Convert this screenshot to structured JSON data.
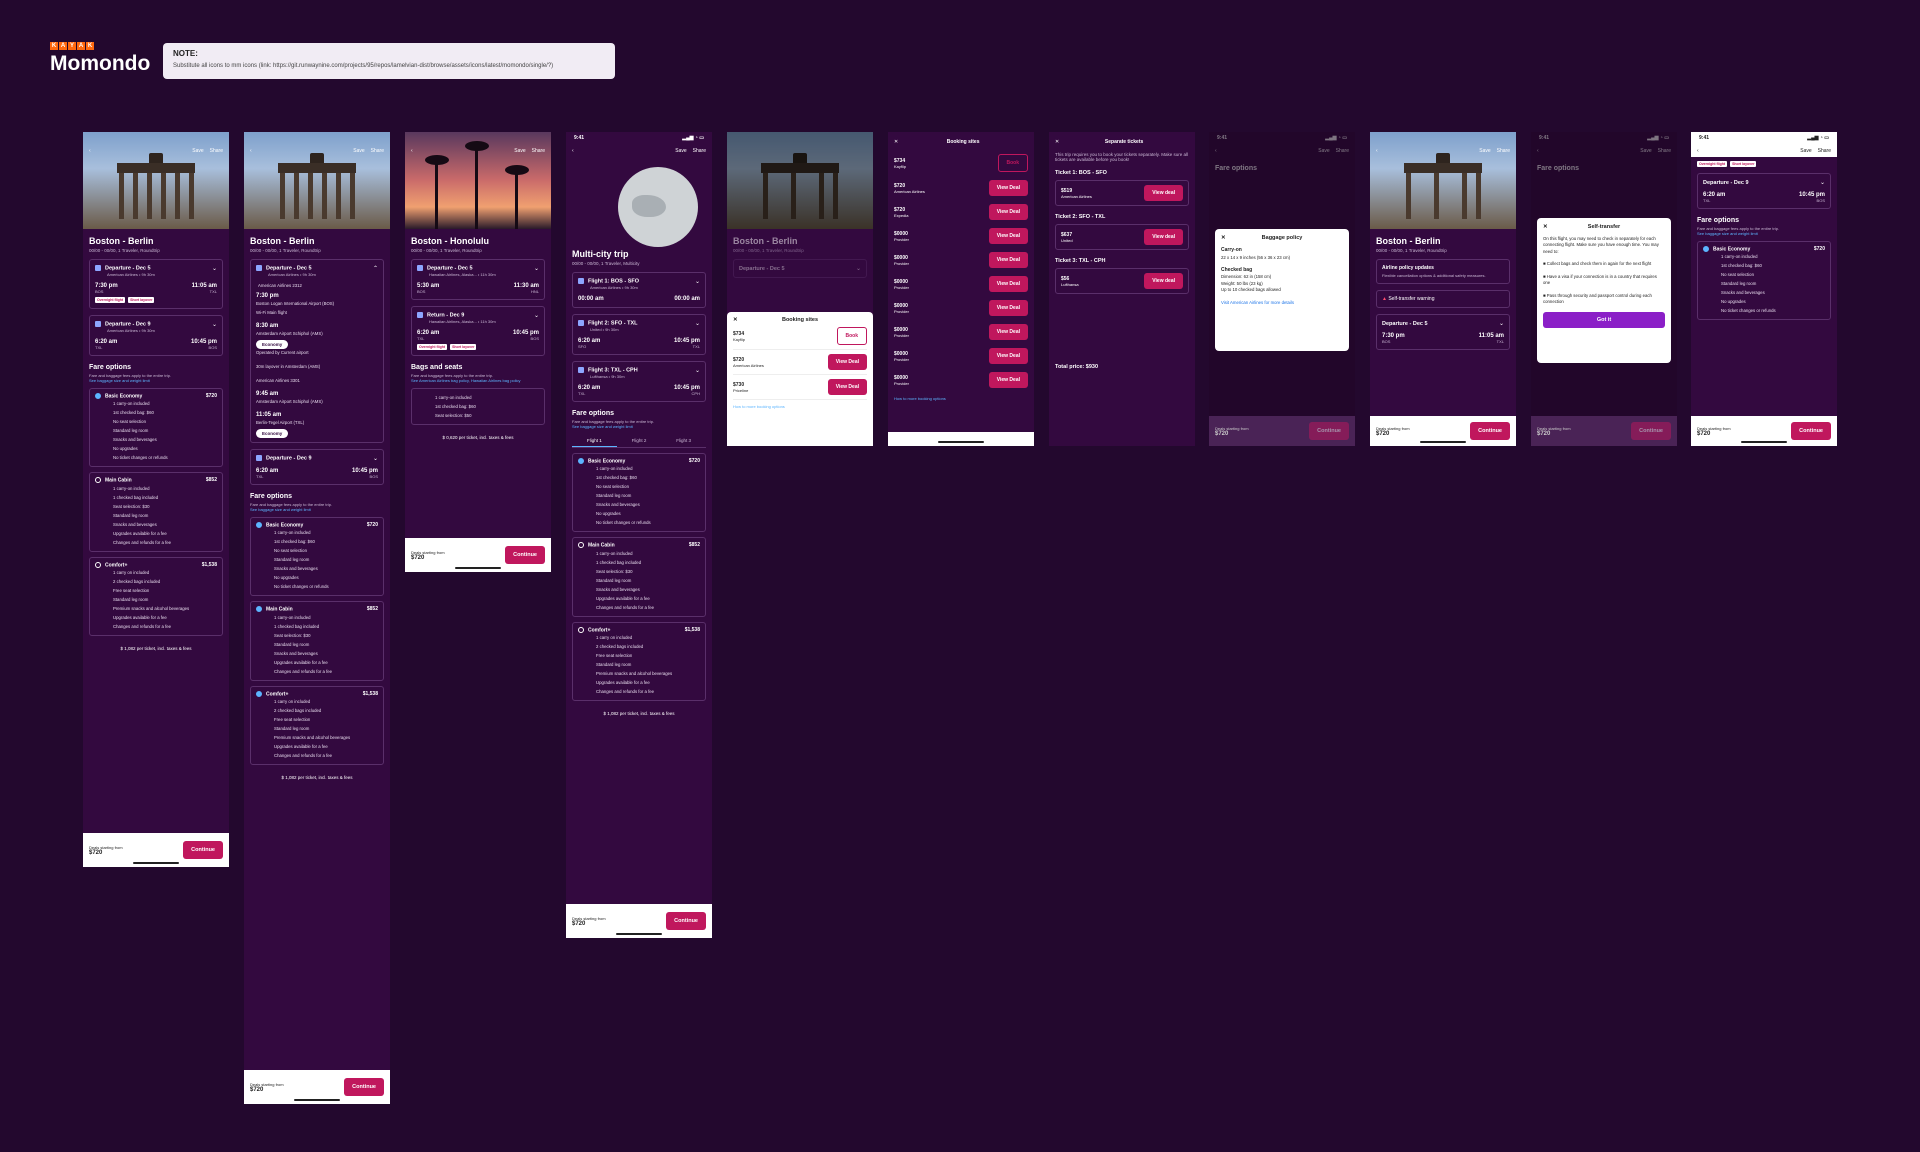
{
  "brand": {
    "kayak": "KAYAK",
    "name": "Momondo"
  },
  "note": {
    "title": "NOTE:",
    "body": "Substitute all icons to mm icons (link: https://git.runwaynine.com/projects/95/repos/lamelvian-dist/browse/assets/icons/latest/momondo/single/?)"
  },
  "status": {
    "time": "9:41"
  },
  "nav": {
    "save": "Save",
    "share": "Share"
  },
  "trips": {
    "bos_ber": {
      "title": "Boston - Berlin",
      "sub": "00/00 - 00/00, 1 Traveler, Roundtrip"
    },
    "bos_hnl": {
      "title": "Boston - Honolulu",
      "sub": "00/00 - 00/00, 1 Traveler, Roundtrip"
    },
    "multi": {
      "title": "Multi-city trip",
      "sub": "00/00 - 00/00, 1 Traveler, Multicity"
    }
  },
  "flights": {
    "dep": {
      "title": "Departure - Dec 5",
      "airline": "American Airlines • 9h 30m",
      "t1": "7:30 pm",
      "a1": "BOS",
      "d1": "Thu, Dec 5",
      "t2": "11:05 am",
      "a2": "TXL",
      "d2": "Fri, Dec 6",
      "stop": "1 stop"
    },
    "ret": {
      "title": "Departure - Dec 9",
      "airline": "American Airlines • 9h 30m",
      "t1": "6:20 am",
      "a1": "TXL",
      "d1": "Mon, Dec 9",
      "t2": "10:45 pm",
      "a2": "BOS",
      "d2": "Mon, Dec 9",
      "stop": "1 stop"
    },
    "hnl_dep": {
      "title": "Departure - Dec 5",
      "airline": "Hawaiian Airlines, Alaska... • 11h 30m",
      "t1": "5:30 am",
      "a1": "BOS",
      "t2": "11:30 am",
      "a2": "HNL"
    },
    "hnl_ret": {
      "title": "Return - Dec 9",
      "airline": "Hawaiian Airlines, Alaska... • 11h 30m",
      "t1": "6:20 am",
      "a1": "TXL",
      "t2": "10:45 pm",
      "a2": "BOS"
    }
  },
  "tags": {
    "overnight": "Overnight flight",
    "short": "Short layover"
  },
  "multi": {
    "f1": "Flight 1: BOS - SFO",
    "f1a": "American Airlines • 9h 30m",
    "f1t1": "00:00 am",
    "f1t2": "00:00 am",
    "f2": "Flight 2: SFO - TXL",
    "f2a": "United • 9h 30m",
    "f2t1": "6:20 am",
    "f2t2": "10:45 pm",
    "f2a1": "SFO",
    "f2a2": "TXL",
    "f3": "Flight 3: TXL - CPH",
    "f3a": "Lufthansa • 9h 30m",
    "f3t1": "6:20 am",
    "f3t2": "10:45 pm",
    "f3a1": "TXL",
    "f3a2": "CPH",
    "tabs": [
      "Flight 1",
      "Flight 2",
      "Flight 3"
    ]
  },
  "detail": {
    "airline": "American Airlines 2312",
    "t1": "7:30 pm",
    "ap1": "Boston Logan International Airport (BOS)",
    "d1": "Thursday, Dec 5",
    "wifi": "Wi-Fi Main flight",
    "t2": "8:30 am",
    "ap2": "Amsterdam Airport Schiphol (AMS)",
    "economy": "Economy",
    "op": "Operated by Current airport",
    "layover": "30m  layover in Amsterdam (AMS)",
    "airline2": "American Airlines 3301",
    "t3": "9:45 am",
    "ap3": "Amsterdam Airport Schiphol (AMS)",
    "t4": "11:05 am",
    "ap4": "Berlin-Tegel Airport (TXL)"
  },
  "fares": {
    "title": "Fare options",
    "sub": "Fare and baggage fees apply to the entire trip.",
    "link": "See baggage size and weight limit",
    "basic": {
      "name": "Basic Economy",
      "price": "$720",
      "items": [
        "1 carry-on included",
        "1st checked bag: $60",
        "No seat selection",
        "Standard leg room",
        "Snacks and beverages",
        "No upgrades",
        "No ticket changes or refunds"
      ]
    },
    "main": {
      "name": "Main Cabin",
      "price": "$852",
      "items": [
        "1 carry-on included",
        "1 checked bag included",
        "Seat selection: $30",
        "Standard leg room",
        "Snacks and beverages",
        "Upgrades available for a fee",
        "Changes and refunds for a fee"
      ]
    },
    "comfort": {
      "name": "Comfort+",
      "price": "$1,538",
      "items": [
        "1 carry on included",
        "2 checked bags included",
        "Free seat selection",
        "Standard leg room",
        "Premium snacks and alcohol beverages",
        "Upgrades available for a fee",
        "Changes and refunds for a fee"
      ]
    }
  },
  "bags": {
    "title": "Bags and seats",
    "sub": "Fare and baggage fees apply to the entire trip.",
    "link": "See American Airlines bag policy, Hawaiian Airlines bag policy",
    "items": [
      "1 carry-on included",
      "1st checked bag: $60",
      "Seat selection: $50"
    ],
    "total": "$ 0,620 per ticket, incl. taxes & fees"
  },
  "total": "$ 1,082 per ticket, incl. taxes & fees",
  "bottom": {
    "label": "Deals starting from",
    "price": "$720",
    "btn": "Continue"
  },
  "booking": {
    "title": "Booking sites",
    "book": "Book",
    "view": "View Deal",
    "first": {
      "price": "$734",
      "prov": "Kayflip",
      "sub": "Sponsored"
    },
    "second": {
      "price": "$720",
      "prov": "American Airlines",
      "sub": "Book with Airline"
    },
    "third": {
      "price": "$720",
      "prov": "Expedia"
    },
    "fourth": {
      "price": "$730",
      "prov": "Priceline"
    },
    "generic": {
      "price": "$0000",
      "prov": "Provider"
    },
    "more": "How to more booking options"
  },
  "separate": {
    "title": "Separate tickets",
    "body": "This trip requires you to book your tickets separately. Make sure all tickets are available before you book!",
    "t1": "Ticket 1: BOS - SFO",
    "p1": "$519",
    "a1": "American Airlines",
    "t2": "Ticket 2: SFO - TXL",
    "p2": "$637",
    "a2": "United",
    "t3": "Ticket 3: TXL - CPH",
    "p3": "$56",
    "a3": "Lufthansa",
    "btn": "View deal",
    "total": "Total price: $930"
  },
  "baggage": {
    "title": "Baggage policy",
    "carry": "Carry-on",
    "carry_d": "22 x 14 x 9 inches (56 x 36 x 23 cm)",
    "checked": "Checked bag",
    "checked_d1": "Dimension: 62 in (158 cm)",
    "checked_d2": "Weight: 50 lbs (23 kg)",
    "checked_d3": "Up to 10 checked bags allowed",
    "link": "Visit American Airlines for more details"
  },
  "policy": {
    "t": "Airline policy updates",
    "s": "Flexible cancellation options & additional safety measures.",
    "warn": "Self-transfer warning",
    "dep": "Departure - Dec 5"
  },
  "selftransfer": {
    "title": "Self-transfer",
    "body": "On this flight, you may need to check in separately for each connecting flight. Make sure you have enough time. You may need to:",
    "i1": "Collect bags and check them in again for the next flight",
    "i2": "Have a visa if your connection is in a country that requires one",
    "i3": "Pass through security and passport control during each connection",
    "btn": "Got it"
  }
}
